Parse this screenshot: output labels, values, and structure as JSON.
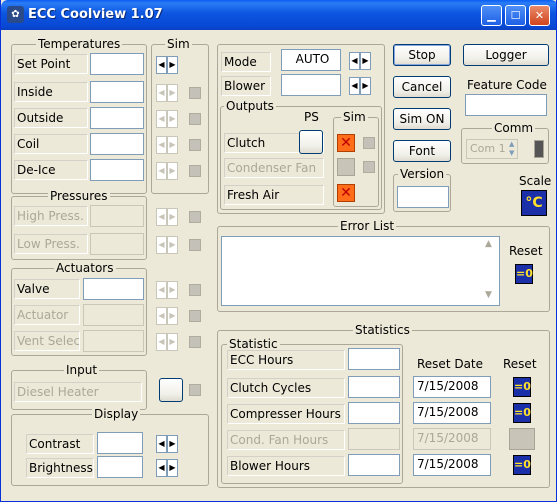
{
  "window": {
    "title": "ECC Coolview 1.07",
    "app_icon": "car-fan-icon",
    "controls": [
      "minimize-icon",
      "maximize-icon",
      "close-icon"
    ]
  },
  "temperatures": {
    "title": "Temperatures",
    "sim_title": "Sim",
    "rows": [
      {
        "label": "Set Point",
        "value": ""
      },
      {
        "label": "Inside",
        "value": ""
      },
      {
        "label": "Outside",
        "value": ""
      },
      {
        "label": "Coil",
        "value": ""
      },
      {
        "label": "De-Ice",
        "value": ""
      }
    ]
  },
  "pressures": {
    "title": "Pressures",
    "rows": [
      {
        "label": "High Press.",
        "value": ""
      },
      {
        "label": "Low Press.",
        "value": ""
      }
    ]
  },
  "actuators": {
    "title": "Actuators",
    "rows": [
      {
        "label": "Valve",
        "value": ""
      },
      {
        "label": "Actuator",
        "value": ""
      },
      {
        "label": "Vent Select",
        "value": ""
      }
    ]
  },
  "input": {
    "title": "Input",
    "rows": [
      {
        "label": "Diesel Heater"
      }
    ]
  },
  "display": {
    "title": "Display",
    "rows": [
      {
        "label": "Contrast",
        "value": ""
      },
      {
        "label": "Brightness",
        "value": ""
      }
    ]
  },
  "mode": {
    "label": "Mode",
    "value": "AUTO"
  },
  "blower": {
    "label": "Blower",
    "value": ""
  },
  "outputs": {
    "title": "Outputs",
    "ps_header": "PS",
    "sim_header": "Sim",
    "rows": [
      {
        "label": "Clutch"
      },
      {
        "label": "Condenser Fan"
      },
      {
        "label": "Fresh Air"
      }
    ]
  },
  "buttons": {
    "stop": "Stop",
    "logger": "Logger",
    "cancel": "Cancel",
    "sim_on": "Sim ON",
    "font": "Font"
  },
  "feature_code": {
    "label": "Feature Code",
    "value": ""
  },
  "comm": {
    "label": "Comm",
    "value": "Com 1"
  },
  "version": {
    "label": "Version",
    "value": ""
  },
  "scale": {
    "label": "Scale",
    "value": "°C"
  },
  "error_list": {
    "title": "Error List",
    "reset_label": "Reset",
    "reset_value": "=0"
  },
  "statistics": {
    "title": "Statistics",
    "statistic_header": "Statistic",
    "reset_date_header": "Reset Date",
    "reset_header": "Reset",
    "rows": [
      {
        "label": "ECC Hours",
        "value": "",
        "date": ""
      },
      {
        "label": "Clutch Cycles",
        "value": "",
        "date": "7/15/2008",
        "reset": "=0"
      },
      {
        "label": "Compresser Hours",
        "value": "",
        "date": "7/15/2008",
        "reset": "=0"
      },
      {
        "label": "Cond. Fan Hours",
        "value": "",
        "date": "7/15/2008",
        "reset": ""
      },
      {
        "label": "Blower Hours",
        "value": "",
        "date": "7/15/2008",
        "reset": "=0"
      }
    ]
  }
}
